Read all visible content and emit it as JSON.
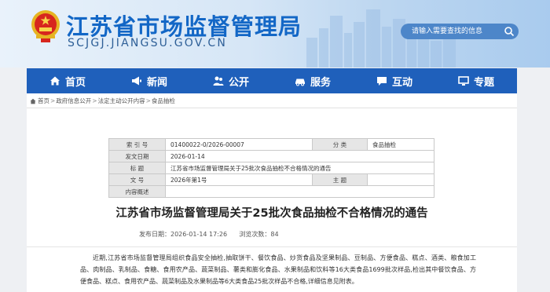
{
  "header": {
    "title": "江苏省市场监督管理局",
    "domain": "SCJGJ.JIANGSU.GOV.CN",
    "search_placeholder": "请输入需要查找的信息"
  },
  "nav": [
    {
      "label": "首页",
      "icon": "home-icon"
    },
    {
      "label": "新闻",
      "icon": "megaphone-icon"
    },
    {
      "label": "公开",
      "icon": "people-icon"
    },
    {
      "label": "服务",
      "icon": "car-icon"
    },
    {
      "label": "互动",
      "icon": "chat-icon"
    },
    {
      "label": "专题",
      "icon": "monitor-icon"
    }
  ],
  "breadcrumb": [
    "首页",
    "政府信息公开",
    "法定主动公开内容",
    "食品抽检"
  ],
  "meta": {
    "index_label": "索 引 号",
    "index_value": "01400022-0/2026-00007",
    "category_label": "分    类",
    "category_value": "食品抽检",
    "date_label": "发文日期",
    "date_value": "2026-01-14",
    "title_label": "标    题",
    "title_value": "江苏省市场监督管理局关于25批次食品抽检不合格情况的通告",
    "docno_label": "文    号",
    "docno_value": "2026年第1号",
    "topic_label": "主    题",
    "topic_value": "",
    "summary_label": "内容概述",
    "summary_value": ""
  },
  "article": {
    "title": "江苏省市场监督管理局关于25批次食品抽检不合格情况的通告",
    "pub_label": "发布日期：",
    "pub_date": "2026-01-14 17:26",
    "views_label": "浏览次数：",
    "views": "84",
    "body": "近期,江苏省市场监督管理局组织食品安全抽检,抽取饼干、餐饮食品、炒货食品及坚果制品、豆制品、方便食品、糕点、酒类、粮食加工品、肉制品、乳制品、食糖、食用农产品、蔬菜制品、薯类和膨化食品、水果制品和饮料等16大类食品1699批次样品,检出其中餐饮食品、方便食品、糕点、食用农产品、蔬菜制品及水果制品等6大类食品25批次样品不合格,详细信息见附表。"
  },
  "colors": {
    "brand": "#1367c6",
    "nav": "#1f60bb"
  }
}
